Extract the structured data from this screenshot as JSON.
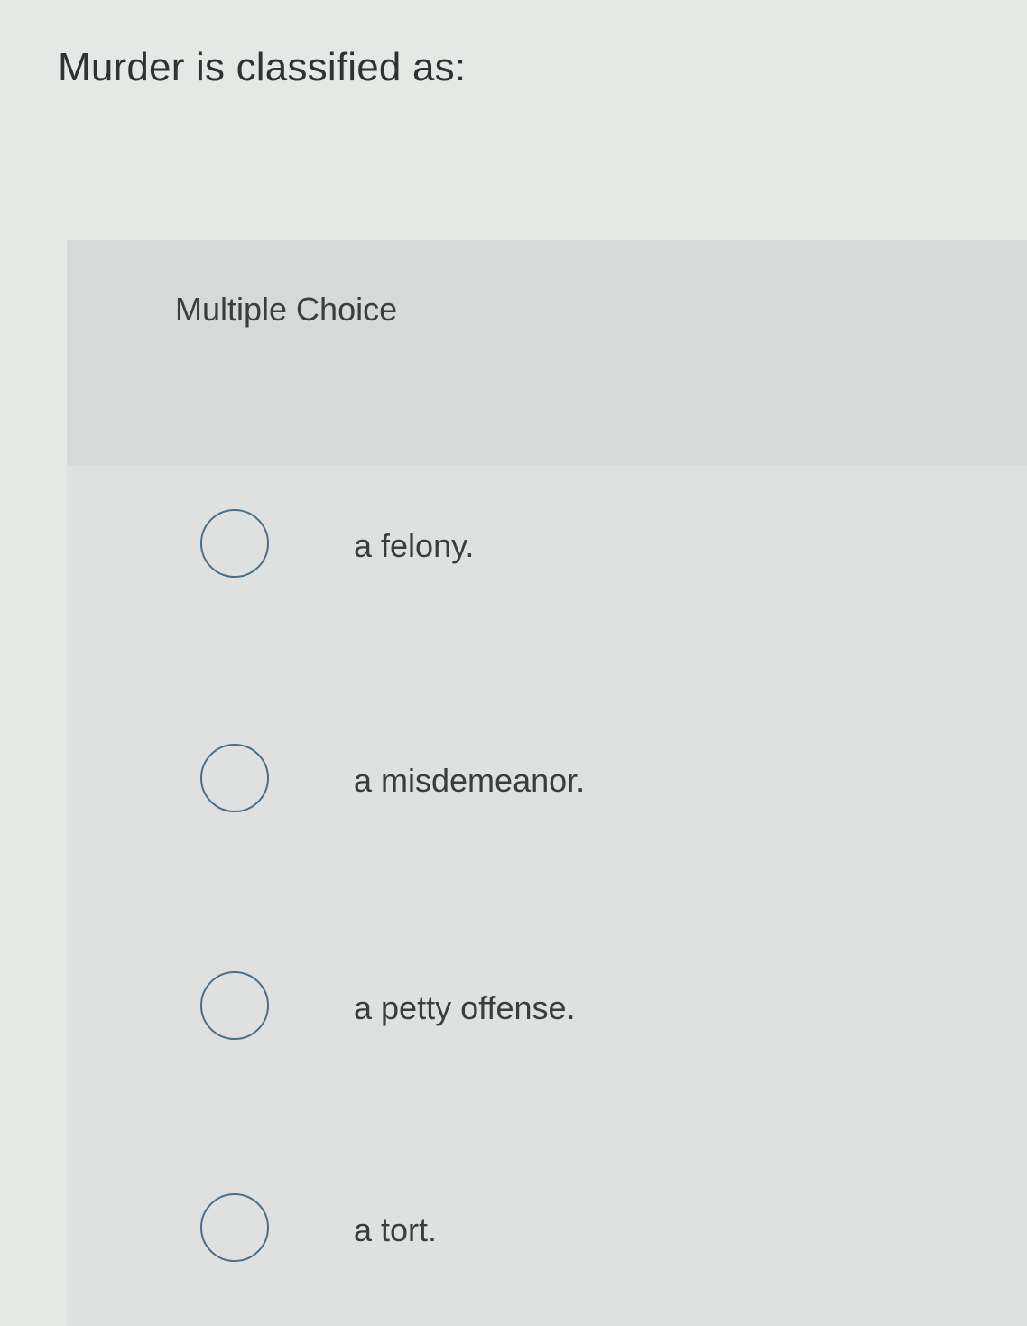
{
  "question": {
    "text": "Murder is classified as:"
  },
  "panel": {
    "label": "Multiple Choice"
  },
  "options": [
    {
      "label": "a felony.",
      "selected": false
    },
    {
      "label": "a misdemeanor.",
      "selected": false
    },
    {
      "label": "a petty offense.",
      "selected": false
    },
    {
      "label": "a tort.",
      "selected": false
    }
  ],
  "colors": {
    "background": "#e6e8e6",
    "panel": "#dfe1e0",
    "panel_header": "#d7d9d8",
    "radio_border": "#4a6f86",
    "text": "#3a3c3e"
  }
}
